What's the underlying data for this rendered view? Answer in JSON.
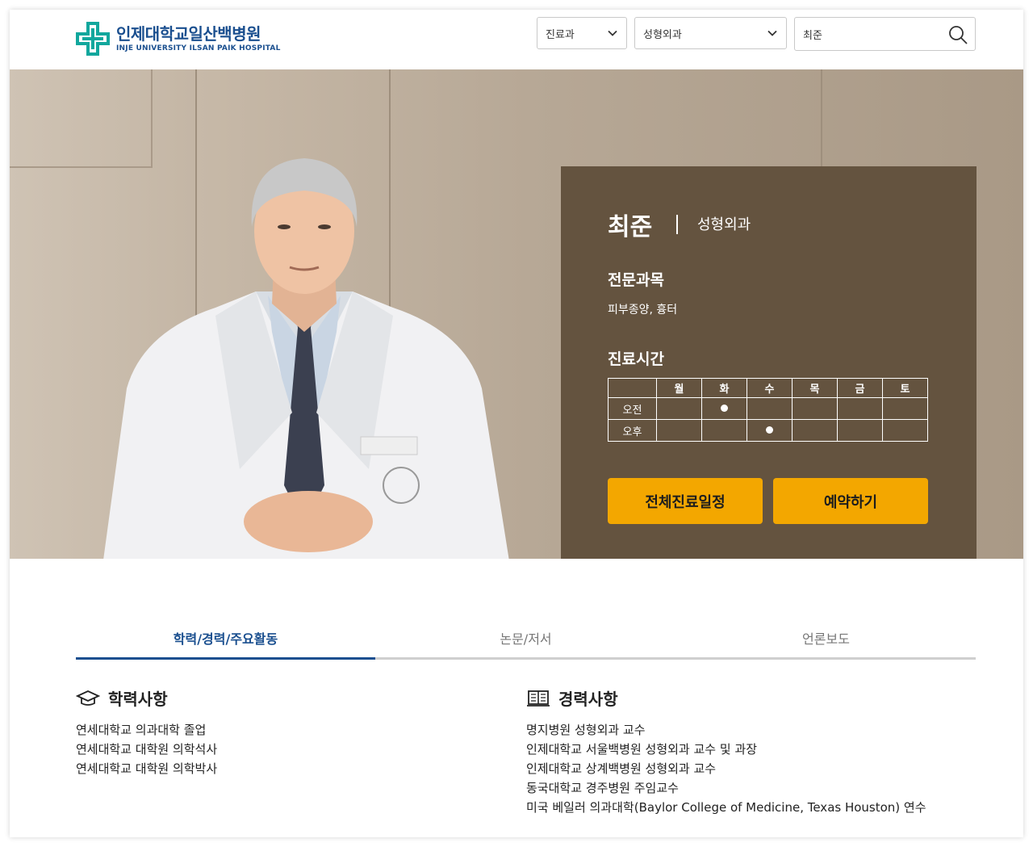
{
  "header": {
    "logo_ko": "인제대학교일산백병원",
    "logo_en": "INJE UNIVERSITY ILSAN PAIK HOSPITAL",
    "select1_value": "진료과",
    "select2_value": "성형외과",
    "search_value": "최준"
  },
  "doctor": {
    "name": "최준",
    "dept": "성형외과",
    "specialty_title": "전문과목",
    "specialty": "피부종양, 흉터",
    "schedule_title": "진료시간",
    "days": [
      "월",
      "화",
      "수",
      "목",
      "금",
      "토"
    ],
    "rows": [
      {
        "label": "오전",
        "slots": [
          false,
          true,
          false,
          false,
          false,
          false
        ]
      },
      {
        "label": "오후",
        "slots": [
          false,
          false,
          true,
          false,
          false,
          false
        ]
      }
    ],
    "btn_schedule": "전체진료일정",
    "btn_reserve": "예약하기"
  },
  "tabs": [
    "학력/경력/주요활동",
    "논문/저서",
    "언론보도"
  ],
  "education": {
    "title": "학력사항",
    "items": [
      "연세대학교 의과대학 졸업",
      "연세대학교 대학원 의학석사",
      "연세대학교 대학원 의학박사"
    ]
  },
  "career": {
    "title": "경력사항",
    "items": [
      "명지병원 성형외과 교수",
      "인제대학교 서울백병원 성형외과 교수 및 과장",
      "인제대학교 상계백병원 성형외과 교수",
      "동국대학교 경주병원 주임교수",
      "미국 베일러 의과대학(Baylor College of Medicine, Texas Houston) 연수"
    ]
  },
  "colors": {
    "brand": "#1a4f8f",
    "logo_teal": "#12a79d",
    "info_box": "#64533f",
    "button": "#f3a700"
  }
}
